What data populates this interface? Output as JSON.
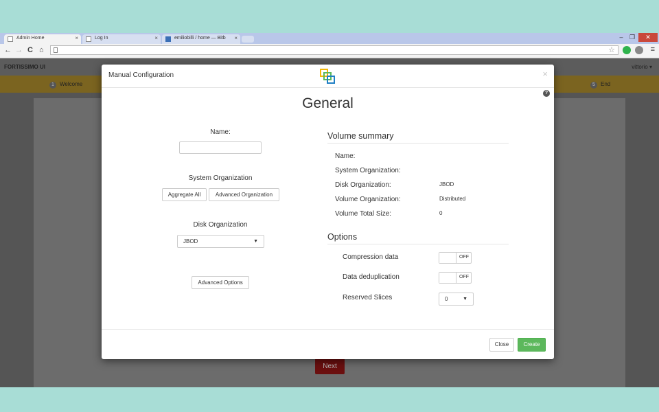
{
  "browser": {
    "tabs": [
      {
        "title": "Admin Home",
        "active": true
      },
      {
        "title": "Log In",
        "active": false
      },
      {
        "title": "emiliobilli / home — Bitb",
        "active": false
      }
    ],
    "window_controls": {
      "minimize": "–",
      "restore": "❐",
      "close": "✕"
    },
    "nav": {
      "back": "←",
      "forward": "→",
      "reload": "C",
      "home": "⌂"
    },
    "address": "",
    "star": "☆",
    "menu": "≡"
  },
  "app": {
    "brand": "FORTISSIMO UI",
    "user": "vittorio ▾",
    "steps": [
      {
        "num": "1",
        "label": "Welcome"
      },
      {
        "num": "5",
        "label": "End"
      }
    ],
    "next_label": "Next"
  },
  "modal": {
    "title": "Manual Configuration",
    "close": "×",
    "help": "?",
    "heading": "General",
    "name_label": "Name:",
    "name_value": "",
    "system_org_label": "System Organization",
    "aggregate_all": "Aggregate All",
    "advanced_org": "Advanced Organization",
    "disk_org_label": "Disk Organization",
    "disk_org_value": "JBOD",
    "advanced_options": "Advanced Options",
    "summary": {
      "title": "Volume summary",
      "rows": [
        {
          "label": "Name:",
          "value": ""
        },
        {
          "label": "System Organization:",
          "value": ""
        },
        {
          "label": "Disk Organization:",
          "value": "JBOD"
        },
        {
          "label": "Volume Organization:",
          "value": "Distributed"
        },
        {
          "label": "Volume Total Size:",
          "value": "0"
        }
      ]
    },
    "options": {
      "title": "Options",
      "compression_label": "Compression data",
      "compression_state": "OFF",
      "dedup_label": "Data deduplication",
      "dedup_state": "OFF",
      "reserved_label": "Reserved Slices",
      "reserved_value": "0"
    },
    "close_btn": "Close",
    "create_btn": "Create"
  },
  "colors": {
    "outer_bg": "#a8ddd6",
    "create_green": "#5cb85c",
    "next_red": "#6b0f0f",
    "steps_bar": "#7b6420"
  }
}
